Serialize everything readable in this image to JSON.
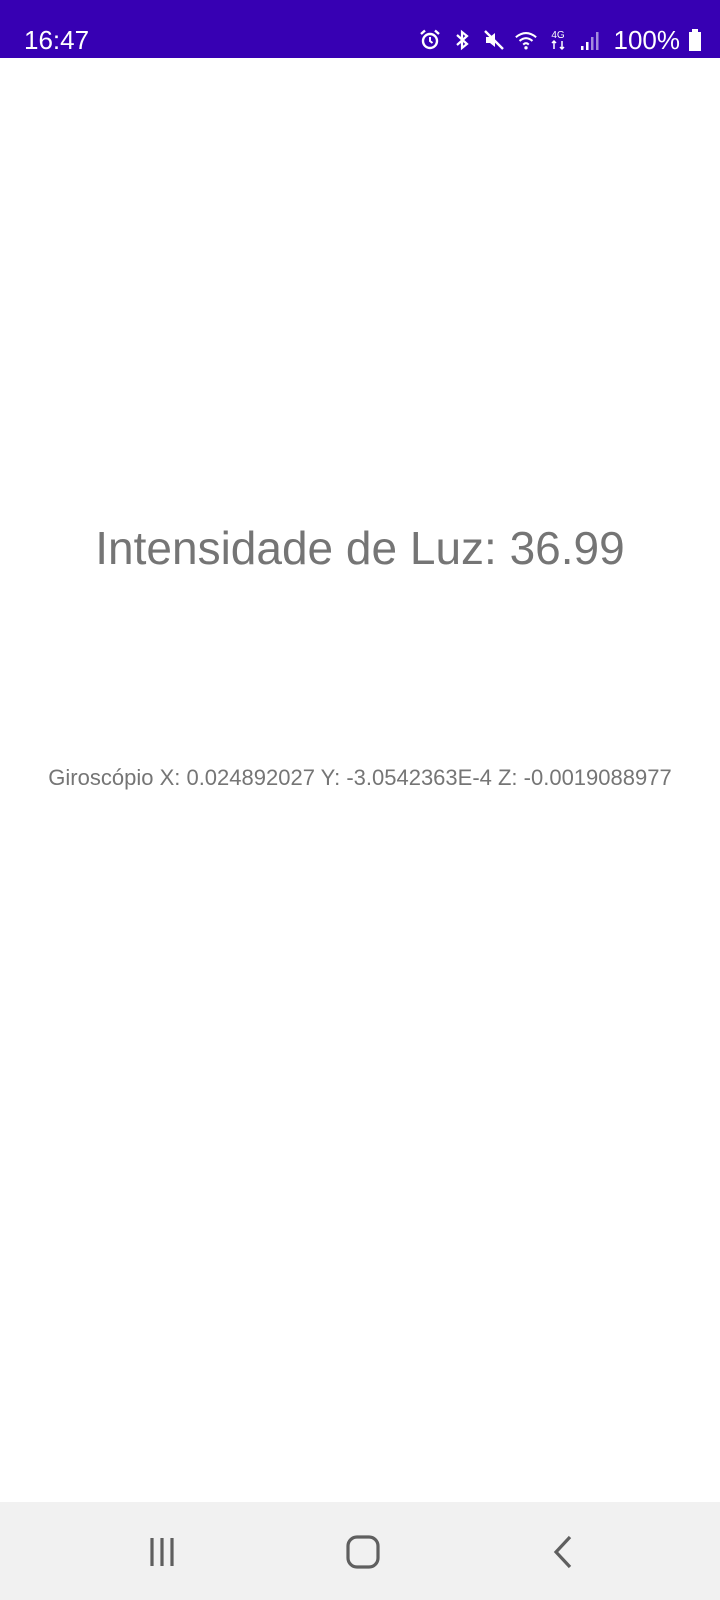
{
  "status_bar": {
    "time": "16:47",
    "battery": "100%",
    "network": "4G",
    "icons": [
      "alarm-icon",
      "bluetooth-icon",
      "mute-icon",
      "wifi-icon",
      "network-4g-icon",
      "signal-icon",
      "battery-icon"
    ],
    "background_color": "#3700b3"
  },
  "main": {
    "light_intensity": "Intensidade de Luz: 36.99",
    "gyroscope": "Giroscópio X: 0.024892027 Y: -3.0542363E-4 Z: -0.0019088977",
    "text_color": "#757575"
  },
  "nav_bar": {
    "buttons": [
      "recents-icon",
      "home-icon",
      "back-icon"
    ],
    "background_color": "#f1f1f1"
  }
}
